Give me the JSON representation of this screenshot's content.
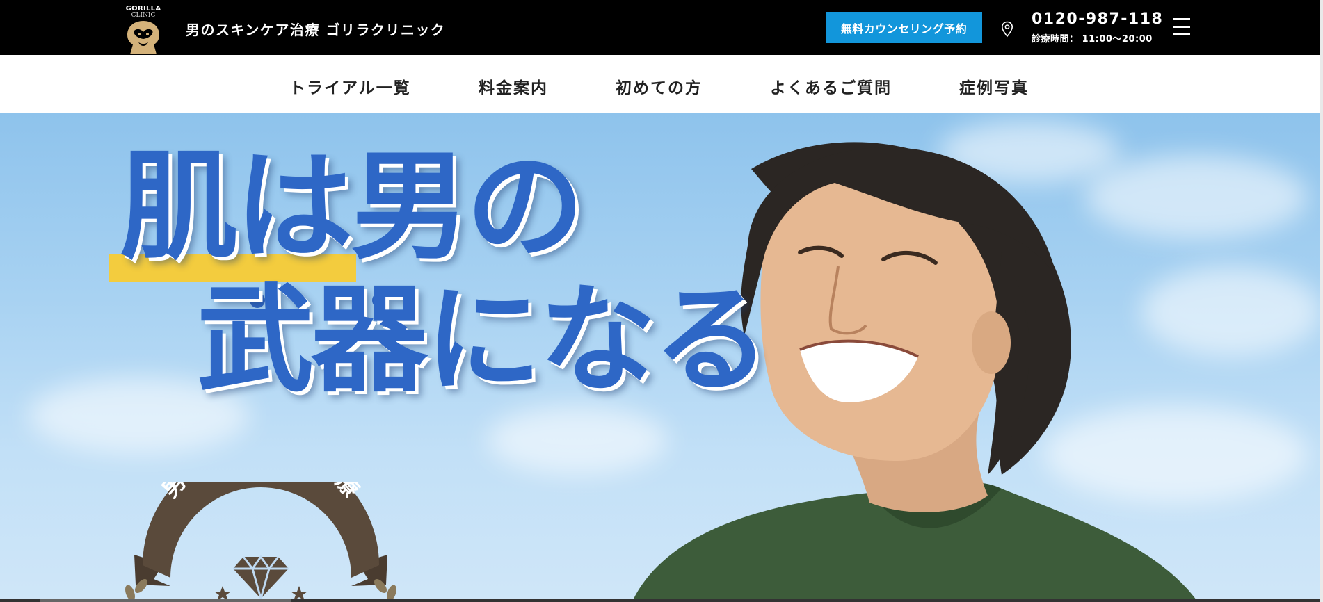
{
  "logo": {
    "line1": "GORILLA",
    "line2": "CLINIC"
  },
  "header": {
    "site_title": "男のスキンケア治療 ゴリラクリニック",
    "reserve_button": "無料カウンセリング予約",
    "phone": "0120-987-118",
    "hours": "診療時間： 11:00〜20:00"
  },
  "nav": {
    "items": [
      {
        "label": "トライアル一覧"
      },
      {
        "label": "料金案内"
      },
      {
        "label": "初めての方"
      },
      {
        "label": "よくあるご質問"
      },
      {
        "label": "症例写真"
      }
    ]
  },
  "hero": {
    "headline_line1": "肌は男の",
    "headline_line2": "武器になる",
    "badge_text": "男性スキンケア治療"
  },
  "colors": {
    "accent": "#1296db",
    "headline": "#2e67c6",
    "highlight": "#f3cc3e",
    "badge": "#5a4a3b",
    "logo_gold": "#d4b27a"
  },
  "icons": [
    "map-pin-icon",
    "hamburger-menu-icon",
    "diamond-icon",
    "star-icon",
    "laurel-icon"
  ]
}
